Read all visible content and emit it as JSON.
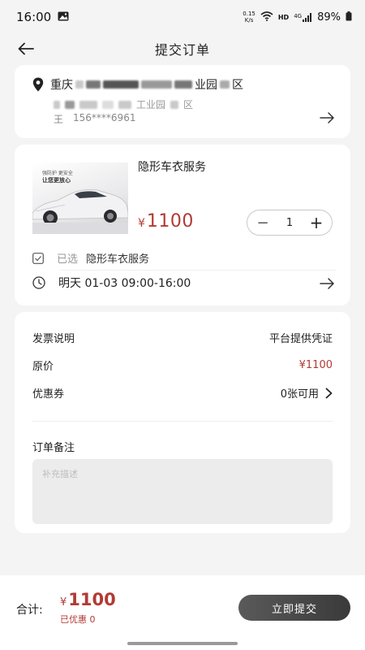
{
  "status_bar": {
    "time": "16:00",
    "net_speed_value": "0.15",
    "net_speed_unit": "K/s",
    "hd": "HD",
    "network": "4G",
    "battery": "89%"
  },
  "header": {
    "title": "提交订单"
  },
  "address": {
    "line1_start": "重庆",
    "line1_visible": "业园",
    "line1_end": "区",
    "line2_visible": "工业园",
    "line2_end": "区",
    "name": "王",
    "phone": "156****6961"
  },
  "service": {
    "image_tagline": "强防护 更安全",
    "image_headline": "让您更放心",
    "title": "隐形车衣服务",
    "price_currency": "¥",
    "price_amount": "1100",
    "quantity": "1",
    "minus_symbol": "−",
    "plus_symbol": "+",
    "selected_label": "已选",
    "selected_value": "隐形车衣服务",
    "time_slot": "明天 01-03 09:00-16:00"
  },
  "order_info": {
    "invoice_label": "发票说明",
    "invoice_value": "平台提供凭证",
    "original_price_label": "原价",
    "original_price_value": "¥1100",
    "coupon_label": "优惠券",
    "coupon_value": "0张可用",
    "remark_label": "订单备注",
    "remark_placeholder": "补充描述"
  },
  "footer": {
    "total_label": "合计:",
    "total_currency": "¥",
    "total_amount": "1100",
    "discount_text": "已优惠  0",
    "submit_label": "立即提交"
  },
  "colors": {
    "accent_red": "#b23a34",
    "button_dark": "#4a4a4a",
    "background": "#f4f4f4"
  }
}
